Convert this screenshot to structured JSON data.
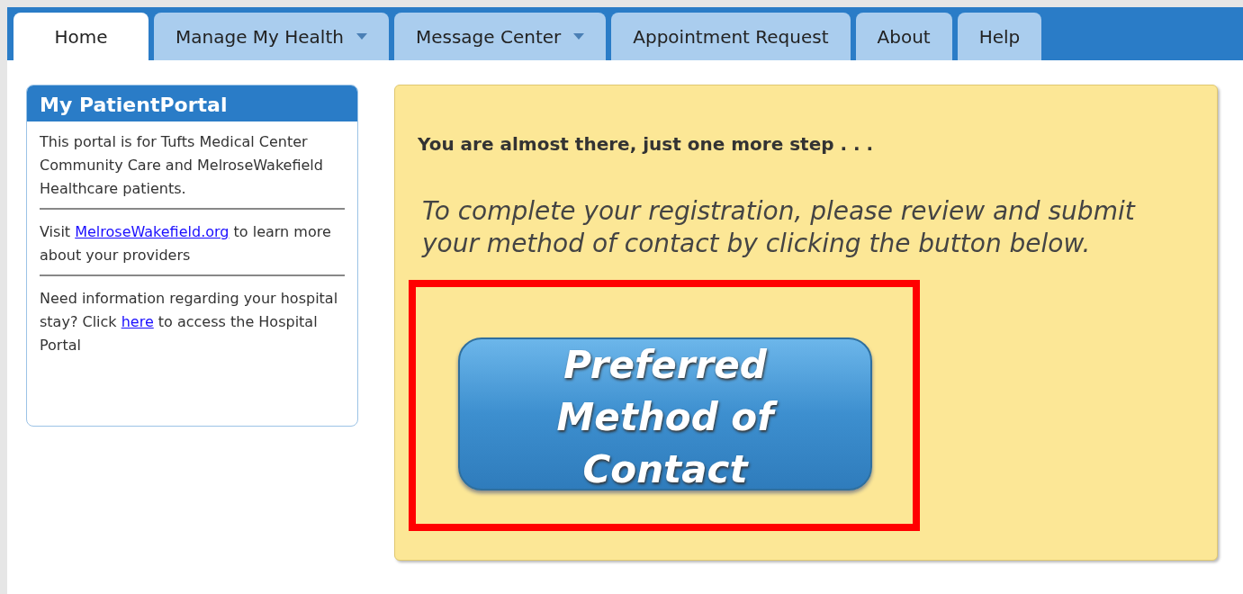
{
  "tabs": [
    {
      "label": "Home",
      "selected": true,
      "has_menu": false
    },
    {
      "label": "Manage My Health",
      "selected": false,
      "has_menu": true
    },
    {
      "label": "Message Center",
      "selected": false,
      "has_menu": true
    },
    {
      "label": "Appointment Request",
      "selected": false,
      "has_menu": false
    },
    {
      "label": "About",
      "selected": false,
      "has_menu": false
    },
    {
      "label": "Help",
      "selected": false,
      "has_menu": false
    }
  ],
  "sidebar": {
    "title": "My PatientPortal",
    "paragraphs": [
      [
        {
          "kind": "text",
          "text": "This portal is for Tufts Medical Center Community Care and MelroseWakefield Healthcare patients."
        }
      ],
      [
        {
          "kind": "text",
          "text": "Visit "
        },
        {
          "kind": "link",
          "text": "MelroseWakefield.org"
        },
        {
          "kind": "text",
          "text": " to learn more about your providers"
        }
      ],
      [
        {
          "kind": "text",
          "text": "Need information regarding your hospital stay? Click "
        },
        {
          "kind": "link",
          "text": "here"
        },
        {
          "kind": "text",
          "text": " to access the Hospital Portal"
        }
      ]
    ]
  },
  "main": {
    "heading": "You are almost there, just one more step . . .",
    "instruction": "To complete your registration, please review and submit your method of contact by clicking the button below.",
    "button": "Preferred Method of Contact"
  }
}
